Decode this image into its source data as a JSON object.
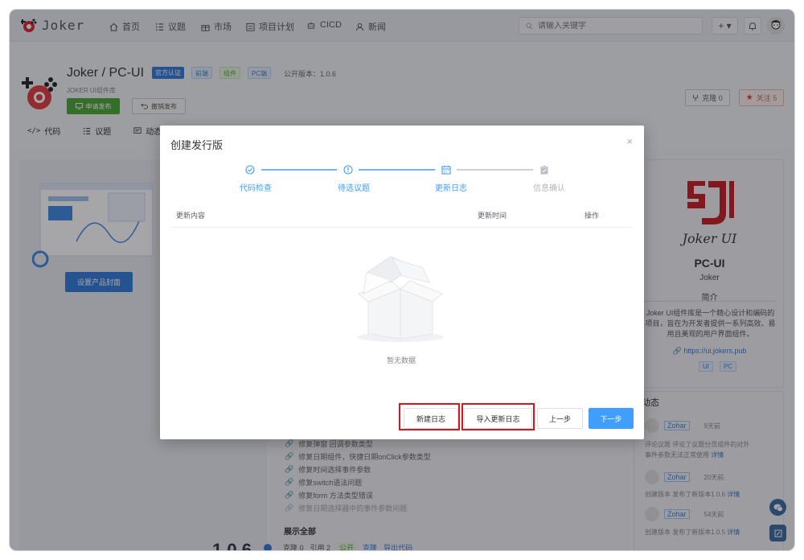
{
  "colors": {
    "accent": "#409eff",
    "green": "#4aa52f",
    "highlight": "#d9141b",
    "brand_red": "#c8181e"
  },
  "nav": {
    "logo_text": "Joker",
    "items": [
      {
        "label": "首页",
        "icon": "home-icon"
      },
      {
        "label": "议题",
        "icon": "list-icon"
      },
      {
        "label": "市场",
        "icon": "gift-icon"
      },
      {
        "label": "项目计划",
        "icon": "calendar-icon"
      },
      {
        "label": "CICD",
        "icon": "robot-icon"
      },
      {
        "label": "新闻",
        "icon": "user-icon"
      }
    ],
    "search_placeholder": "请输入关键字",
    "plus_label": "+ ▾"
  },
  "project": {
    "title": "Joker / PC-UI",
    "tags": [
      "官方认证",
      "前端",
      "组件",
      "PC端"
    ],
    "version_text": "公开版本：1.0.6",
    "subtitle": "JOKER UI组件库",
    "publish_label": "申请发布",
    "revoke_label": "撤销发布",
    "clone_label": "克隆 0",
    "follow_label": "关注 5",
    "tabs": [
      {
        "label": "代码",
        "icon": "code-icon"
      },
      {
        "label": "议题",
        "icon": "list-icon"
      },
      {
        "label": "动态",
        "icon": "message-icon"
      }
    ]
  },
  "left": {
    "cover_button": "设置产品封面"
  },
  "changes": [
    "修复弹窗 回调参数类型",
    "修复日期组件，快捷日期onClick参数类型",
    "修复时间选择事件参数",
    "修复switch语法问题",
    "修复form 方法类型错误",
    "修复日期选择器中的事件参数问题"
  ],
  "show_all": "展示全部",
  "bottom": {
    "version": "1.0.6",
    "clone": "克隆 0",
    "refs": "引用 2",
    "public": "公开",
    "clone2": "克隆",
    "export": "导出代码"
  },
  "right": {
    "brand": "Joker UI",
    "name": "PC-UI",
    "owner": "Joker",
    "intro_title": "简介",
    "intro": "Joker UI组件库是一个精心设计和编码的项目，旨在为开发者提供一系列高效、易用且美观的用户界面组件。",
    "link": "https://ui.jokers.pub",
    "tags": [
      "UI",
      "PC"
    ],
    "feed_title": "动态",
    "feed": [
      {
        "user": "Zohar",
        "time": "9天前",
        "text": "评论议题 评论了议题分页组件的对外事件参数无法正常使用",
        "more": "详情"
      },
      {
        "user": "Zohar",
        "time": "20天前",
        "text": "创建版本 发布了新版本1.0.6",
        "more": "详情"
      },
      {
        "user": "Zohar",
        "time": "54天前",
        "text": "创建版本 发布了新版本1.0.5",
        "more": "详情"
      }
    ]
  },
  "modal": {
    "title": "创建发行版",
    "close": "×",
    "steps": [
      {
        "label": "代码检查",
        "state": "done"
      },
      {
        "label": "待选议题",
        "state": "done"
      },
      {
        "label": "更新日志",
        "state": "active"
      },
      {
        "label": "信息确认",
        "state": "pending"
      }
    ],
    "columns": [
      "更新内容",
      "更新时间",
      "操作"
    ],
    "empty_text": "暂无数据",
    "buttons": {
      "new_log": "新建日志",
      "import_log": "导入更新日志",
      "prev": "上一步",
      "next": "下一步"
    }
  }
}
